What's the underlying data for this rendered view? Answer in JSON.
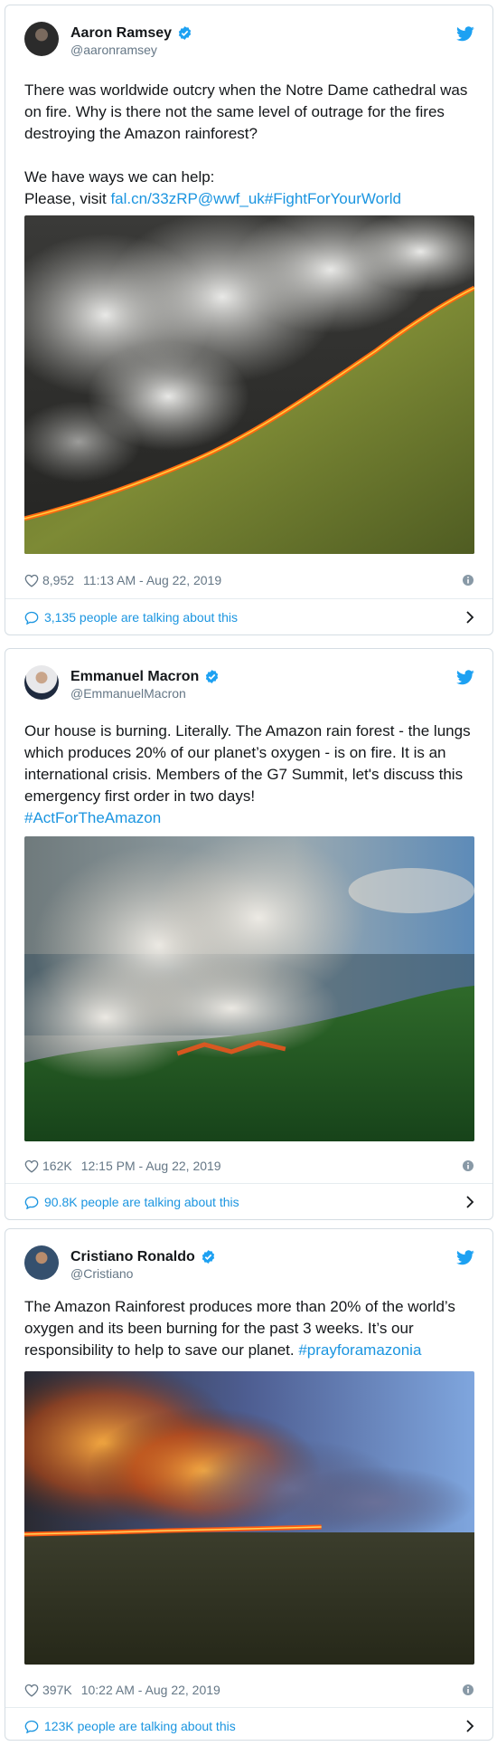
{
  "tweets": [
    {
      "name": "Aaron Ramsey",
      "handle": "@aaronramsey",
      "text_p1": "There was worldwide outcry when the Notre Dame cathedral was on fire. Why is there not the same level of outrage for the fires destroying the Amazon rainforest?",
      "text_p2_line1": "We have ways we can help:",
      "text_p2_prefix": "Please, visit ",
      "link1": "fal.cn/33zRP",
      "link2": "@wwf_uk",
      "link3": "#FightForYourWorld",
      "likes": "8,952",
      "timestamp": "11:13 AM - Aug 22, 2019",
      "talking": "3,135 people are talking about this"
    },
    {
      "name": "Emmanuel Macron",
      "handle": "@EmmanuelMacron",
      "text": "Our house is burning. Literally. The Amazon rain forest - the lungs which produces 20% of our planet’s oxygen - is on fire. It is an international crisis. Members of the G7 Summit, let's discuss this emergency first order in two days!",
      "hashtag": "#ActForTheAmazon",
      "likes": "162K",
      "timestamp": "12:15 PM - Aug 22, 2019",
      "talking": "90.8K people are talking about this"
    },
    {
      "name": "Cristiano Ronaldo",
      "handle": "@Cristiano",
      "text": "The Amazon Rainforest produces more than 20% of the world’s oxygen and its been burning for the past 3 weeks. It’s our responsibility to help to save our planet. ",
      "hashtag": "#prayforamazonia",
      "likes": "397K",
      "timestamp": "10:22 AM - Aug 22, 2019",
      "talking": "123K people are talking about this"
    }
  ],
  "colors": {
    "link": "#1b95e0",
    "secondary": "#657786",
    "text": "#14171a",
    "border": "#d5dde3"
  },
  "icons": [
    "verified-badge-icon",
    "twitter-bird-icon",
    "heart-icon",
    "info-icon",
    "speech-bubble-icon",
    "chevron-right-icon"
  ]
}
